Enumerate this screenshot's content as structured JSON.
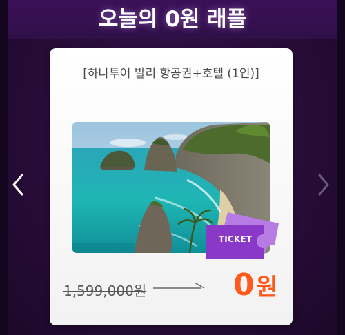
{
  "header": {
    "title": "오늘의 0원 래플"
  },
  "navigation": {
    "prev_icon": "chevron-left-icon",
    "next_icon": "chevron-right-icon"
  },
  "raffle_card": {
    "prize_name": "[하나투어 발리 항공권+호텔 (1인)]",
    "image": "bali-coastline-photo",
    "ticket_badge": "TICKET",
    "original_price": "1,599,000원",
    "sale_price_value": "0",
    "sale_price_unit": "원"
  },
  "colors": {
    "background": "#2a0d3c",
    "ticket_purple": "#8a38c8",
    "price_accent": "#ff5a1e",
    "card": "#ffffff"
  }
}
